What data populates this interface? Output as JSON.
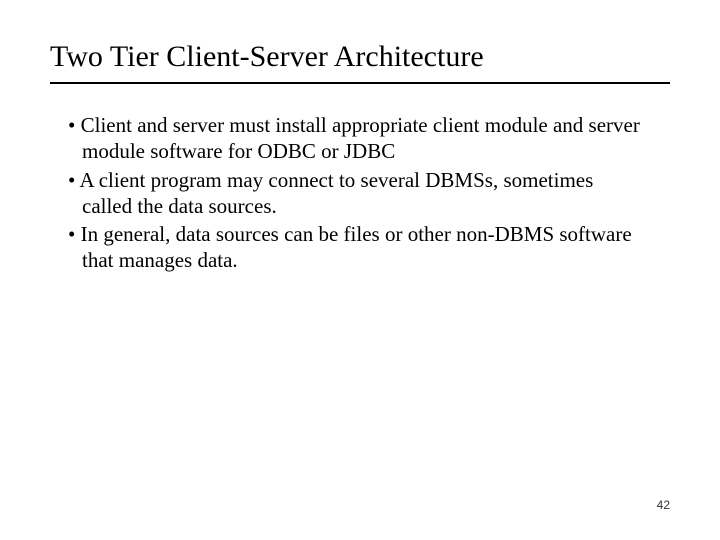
{
  "slide": {
    "title": "Two Tier Client-Server Architecture",
    "bullets": [
      "Client and server must install appropriate client module and server module software for ODBC or JDBC",
      "A client program may connect to several DBMSs, sometimes called the data sources.",
      "In general, data sources can be files or other non-DBMS software that manages data."
    ],
    "bullet_marker": "• ",
    "page_number": "42"
  }
}
